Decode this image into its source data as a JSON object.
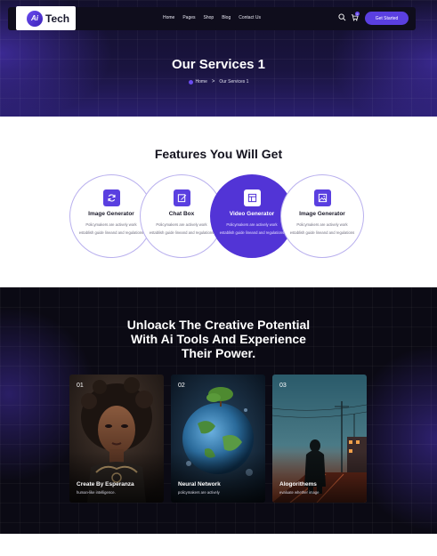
{
  "brand": {
    "name": "Tech",
    "mark": "Ai"
  },
  "nav": {
    "links": [
      "Home",
      "Pages",
      "Shop",
      "Blog",
      "Contact Us"
    ],
    "cart_count": "0",
    "cta_label": "Get Started"
  },
  "hero": {
    "title": "Our Services 1",
    "breadcrumb": {
      "home": "Home",
      "separator": ">",
      "current": "Our Services 1"
    }
  },
  "features": {
    "heading": "Features You Will Get",
    "items": [
      {
        "title": "Image Generator",
        "description": "Policymakers are actively work establish guide lineand and regulations",
        "icon": "refresh-icon",
        "active": false
      },
      {
        "title": "Chat Box",
        "description": "Policymakers are actively work establish guide lineand and regulations",
        "icon": "edit-icon",
        "active": false
      },
      {
        "title": "Video Generator",
        "description": "Policymakers are actively work establish guide lineand and regulations",
        "icon": "layout-icon",
        "active": true
      },
      {
        "title": "Image Generator",
        "description": "Policymakers are actively work establish guide lineand and regulations",
        "icon": "image-icon",
        "active": false
      }
    ]
  },
  "showcase": {
    "heading_lines": [
      "Unloack The Creative Potential",
      "With Ai Tools And Experience",
      "Their Power."
    ],
    "cards": [
      {
        "number": "01",
        "title": "Create By Esperanza",
        "subtitle": "human-like intelligence."
      },
      {
        "number": "02",
        "title": "Neural Network",
        "subtitle": "policymakers are actively"
      },
      {
        "number": "03",
        "title": "Alogorithems",
        "subtitle": "evaluate whether image"
      }
    ]
  },
  "colors": {
    "accent": "#5a3fe0",
    "dark_bg": "#0b0a14",
    "hero_bg": "#1a1440"
  }
}
